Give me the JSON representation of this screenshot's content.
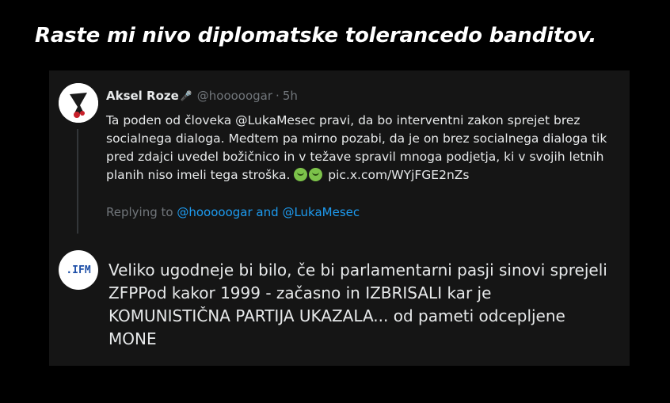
{
  "headline": "Raste mi nivo diplomatske tolerancedo banditov.",
  "quoted_tweet": {
    "author_name": "Aksel Roze",
    "author_badge_icon": "microphone-icon",
    "handle": "@hooooogar",
    "separator": "·",
    "time": "5h",
    "text_before_emoji": "Ta poden od človeka @LukaMesec pravi, da bo interventni zakon sprejet brez socialnega dialoga. Medtem pa mirno pozabi, da je on brez socialnega dialoga tik pred zdajci uvedel božičnico in v težave spravil mnoga podjetja, ki v svojih letnih planih niso imeli tega stroška.",
    "emojis": [
      "nauseated-face",
      "nauseated-face"
    ],
    "link": "pic.x.com/WYjFGE2nZs",
    "replying_to_label": "Replying to",
    "replying_to_user1": "@hooooogar",
    "replying_to_and": "and",
    "replying_to_user2": "@LukaMesec"
  },
  "reply_tweet": {
    "avatar_text": ".IFM",
    "text": "Veliko ugodneje bi bilo, če bi parlamentarni pasji sinovi sprejeli ZFPPod kakor 1999 - začasno in IZBRISALI kar je KOMUNISTIČNA PARTIJA UKAZALA... od pameti odcepljene MONE"
  },
  "colors": {
    "background": "#000000",
    "card": "#151515",
    "text": "#e7e9ea",
    "muted": "#71767b",
    "link": "#1d9bf0"
  }
}
